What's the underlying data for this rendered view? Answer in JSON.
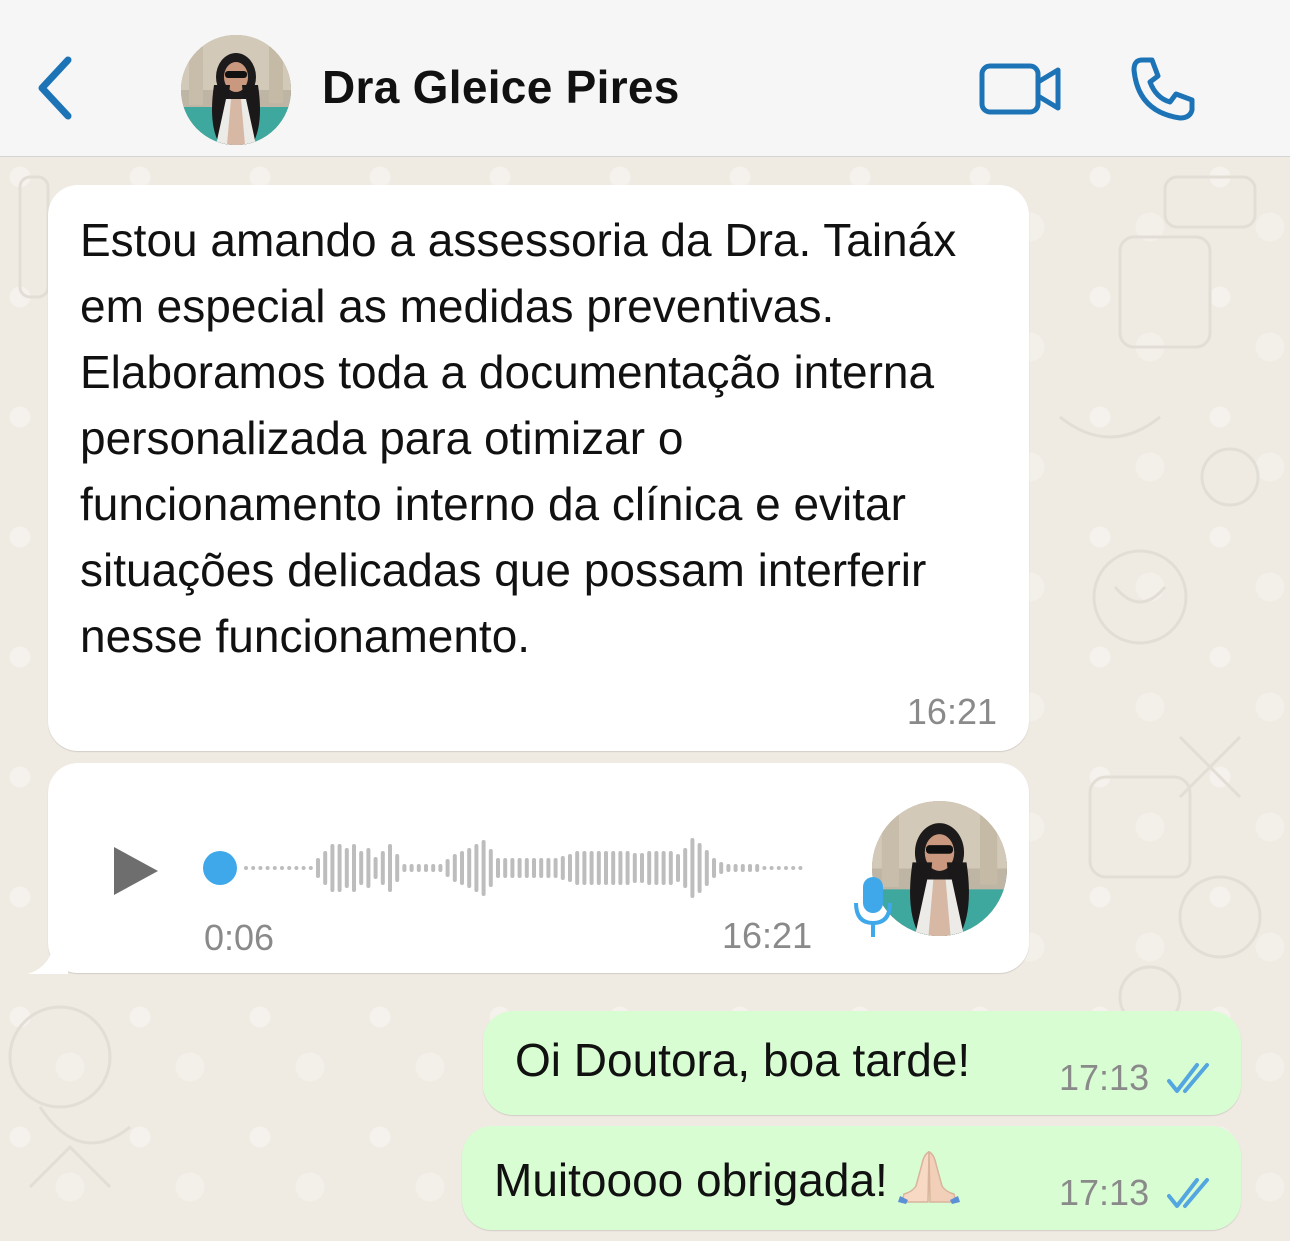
{
  "header": {
    "contact_name": "Dra Gleice Pires",
    "back_icon": "chevron-left-icon",
    "video_icon": "video-camera-icon",
    "call_icon": "phone-icon",
    "accent_color": "#1c74b7"
  },
  "messages": [
    {
      "direction": "incoming",
      "type": "text",
      "text": "Estou amando a assessoria da Dra. Taináx em especial as medidas preventivas. Elaboramos toda a documentação interna personalizada para otimizar o funcionamento interno da clínica e evitar situações delicadas que possam interferir nesse funcionamento.",
      "time": "16:21"
    },
    {
      "direction": "incoming",
      "type": "voice",
      "duration": "0:06",
      "time": "16:21",
      "played_fraction": 0.0
    },
    {
      "direction": "outgoing",
      "type": "text",
      "text": "Oi Doutora, boa tarde!",
      "time": "17:13",
      "status": "read"
    },
    {
      "direction": "outgoing",
      "type": "text",
      "text": "Muitoooo obrigada!",
      "emoji": "folded-hands-emoji",
      "time": "17:13",
      "status": "read"
    }
  ],
  "colors": {
    "incoming_bubble": "#ffffff",
    "outgoing_bubble": "#d9fdd3",
    "read_ticks": "#53a6e0",
    "chat_background": "#efeae2"
  }
}
